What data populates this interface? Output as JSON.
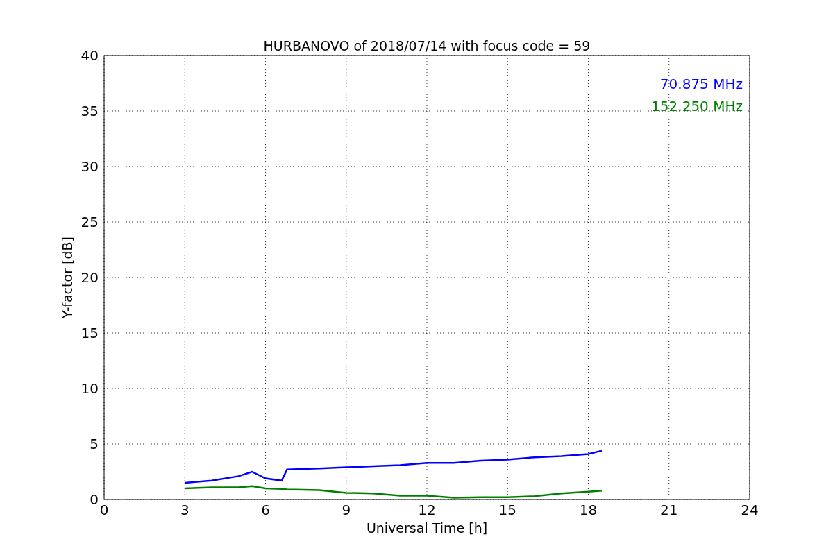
{
  "chart_data": {
    "type": "line",
    "title": "HURBANOVO of 2018/07/14 with focus code = 59",
    "xlabel": "Universal Time [h]",
    "ylabel": "Y-factor [dB]",
    "x": [
      3,
      4,
      5,
      5.5,
      6,
      6.6,
      6.8,
      8,
      9,
      10,
      11,
      12,
      13,
      14,
      15,
      16,
      17,
      18,
      18.5
    ],
    "series": [
      {
        "name": "70.875 MHz",
        "color": "#0000ff",
        "values": [
          1.5,
          1.7,
          2.1,
          2.5,
          1.9,
          1.7,
          2.7,
          2.8,
          2.9,
          3.0,
          3.1,
          3.3,
          3.3,
          3.5,
          3.6,
          3.8,
          3.9,
          4.1,
          4.4
        ]
      },
      {
        "name": "152.250 MHz",
        "color": "#008000",
        "values": [
          1.0,
          1.1,
          1.1,
          1.2,
          1.0,
          0.95,
          0.9,
          0.85,
          0.6,
          0.55,
          0.35,
          0.35,
          0.15,
          0.2,
          0.2,
          0.3,
          0.55,
          0.7,
          0.8
        ]
      }
    ],
    "xlim": [
      0,
      24
    ],
    "ylim": [
      0,
      40
    ],
    "xticks": [
      0,
      3,
      6,
      9,
      12,
      15,
      18,
      21,
      24
    ],
    "yticks": [
      0,
      5,
      10,
      15,
      20,
      25,
      30,
      35,
      40
    ],
    "grid": true
  }
}
